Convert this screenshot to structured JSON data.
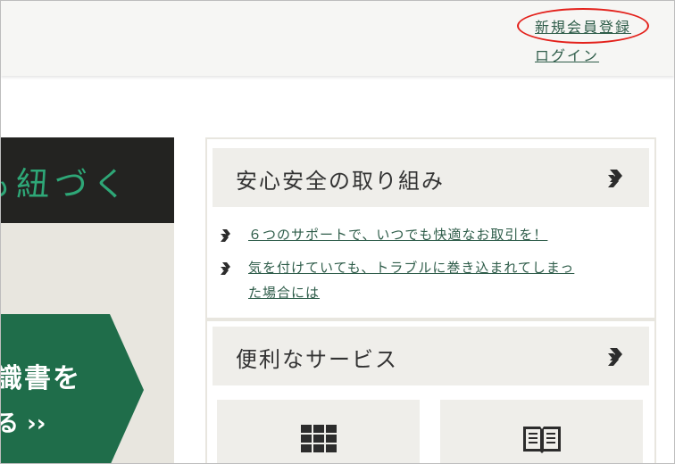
{
  "header": {
    "register_link": "新規会員登録",
    "login_link": "ログイン",
    "annotation_color": "#e3211b"
  },
  "banner": {
    "dark_text": "も紐づく",
    "line1": "識書を",
    "line2": "る ››",
    "accent_color": "#1f6d4a",
    "text_green": "#2ea777"
  },
  "safety": {
    "title": "安心安全の取り組み",
    "icon": "chevron-right-icon",
    "links": [
      {
        "label": "６つのサポートで、いつでも快適なお取引を！",
        "icon": "bullet-arrow-icon"
      },
      {
        "label_line1": "気を付けていても、トラブルに巻き込まれてしまっ",
        "label_line2": "た場合には",
        "icon": "bullet-arrow-icon"
      }
    ]
  },
  "services": {
    "title": "便利なサービス",
    "icon": "chevron-right-icon",
    "tiles": [
      {
        "icon": "grid-icon"
      },
      {
        "icon": "book-icon"
      }
    ]
  },
  "colors": {
    "link": "#2f5d4a",
    "panel_bg": "#e8e6df",
    "section_bg": "#efeeea"
  }
}
